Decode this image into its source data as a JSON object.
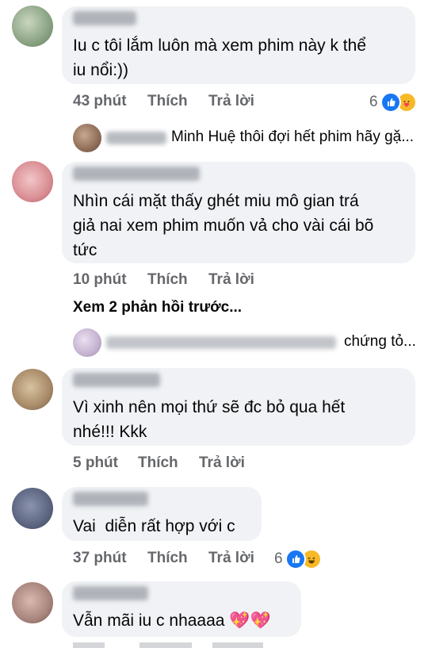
{
  "comments": [
    {
      "text": "Iu c tôi lắm luôn mà xem phim này k thể\niu nổi:))",
      "time": "43 phút",
      "like": "Thích",
      "reply": "Trả lời",
      "reaction_count": "6",
      "reaction_icons": [
        "like-icon",
        "care-icon"
      ]
    },
    {
      "text": "Nhìn cái mặt thấy ghét miu mô gian trá\ngiả nai xem phim muốn vả cho vài cái bõ\ntức",
      "time": "10 phút",
      "like": "Thích",
      "reply": "Trả lời"
    },
    {
      "text": "Vì xinh nên mọi thứ sẽ đc bỏ qua hết\nnhé!!! Kkk",
      "time": "5 phút",
      "like": "Thích",
      "reply": "Trả lời"
    },
    {
      "text": "Vai  diễn rất hợp với c",
      "time": "37 phút",
      "like": "Thích",
      "reply": "Trả lời",
      "reaction_count": "6",
      "reaction_icons": [
        "like-icon",
        "haha-icon"
      ]
    },
    {
      "text": "Vẫn mãi iu c nhaaaa",
      "emoji": "💖💖"
    }
  ],
  "replies": [
    {
      "text": "Minh Huệ thôi đợi hết phim hãy gặ..."
    },
    {
      "text": "chứng tỏ..."
    }
  ],
  "view_more": "Xem 2 phản hồi trước...",
  "colors": {
    "bubble": "#f0f2f5",
    "meta": "#65676b",
    "like_blue": "#1877f2",
    "haha_yellow": "#f7b928"
  }
}
